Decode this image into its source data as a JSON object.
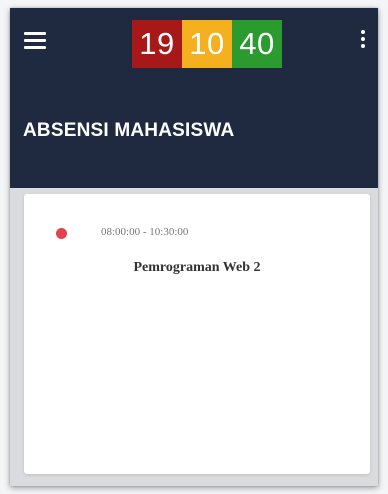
{
  "appbar": {
    "menu_icon": "hamburger-menu-icon",
    "more_icon": "more-vertical-icon",
    "background": "#1f2a40"
  },
  "clock": {
    "hours": "19",
    "minutes": "10",
    "seconds": "40",
    "colors": {
      "hours": "#a81818",
      "minutes": "#f4b01f",
      "seconds": "#2b9a2f"
    }
  },
  "header": {
    "title": "ABSENSI MAHASISWA"
  },
  "schedule": {
    "items": [
      {
        "time": "08:00:00 - 10:30:00",
        "course": "Pemrograman Web 2",
        "status_color": "#e0424f"
      }
    ]
  }
}
